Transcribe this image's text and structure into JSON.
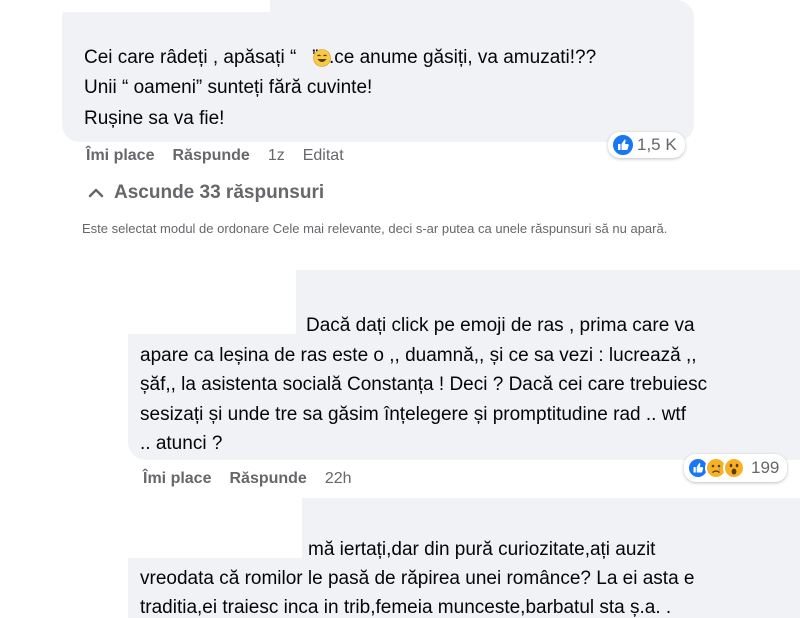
{
  "comment1": {
    "lines": [
      "Cei care râdeți , apăsați “   ”...ce anume găsiți, va amuzati!??",
      "Unii “ oameni” sunteți fără cuvinte!",
      "Rușine sa va fie!"
    ],
    "actions": {
      "like": "Îmi place",
      "reply": "Răspunde",
      "time": "1z",
      "edited": "Editat"
    },
    "reactions": {
      "count": "1,5 K",
      "icons": [
        "like-icon"
      ]
    }
  },
  "replies_toggle": {
    "label": "Ascunde 33 răspunsuri",
    "icon": "chevron-up-icon"
  },
  "sort_notice": "Este selectat modul de ordonare Cele mai relevante, deci s-ar putea ca unele răspunsuri să nu apară.",
  "reply1": {
    "lines": [
      "Dacă dați click pe emoji de ras , prima care va",
      "apare ca leșina de ras este o ,, duamnă,, și ce sa vezi : lucrează ,,",
      "șăf,, la asistenta socială Constanța ! Deci ? Dacă cei care trebuiesc",
      "sesizați și unde tre sa găsim înțelegere și promptitudine rad .. wtf",
      ".. atunci ?"
    ],
    "actions": {
      "like": "Îmi place",
      "reply": "Răspunde",
      "time": "22h"
    },
    "reactions": {
      "count": "199",
      "icons": [
        "like-icon",
        "sad-icon",
        "wow-icon"
      ]
    }
  },
  "reply2": {
    "lines": [
      "mă iertați,dar din pură curiozitate,ați auzit",
      "vreodata că romilor le pasă de răpirea unei românce? La ei asta e",
      "traditia,ei traiesc inca in trib,femeia munceste,barbatul sta ș.a. ."
    ]
  },
  "colors": {
    "bubble": "#f0f2f5",
    "secondary_text": "#65676b",
    "like_blue": "#1877f2",
    "sad_yellow": "#f7b125",
    "wow_yellow": "#f7b125"
  }
}
